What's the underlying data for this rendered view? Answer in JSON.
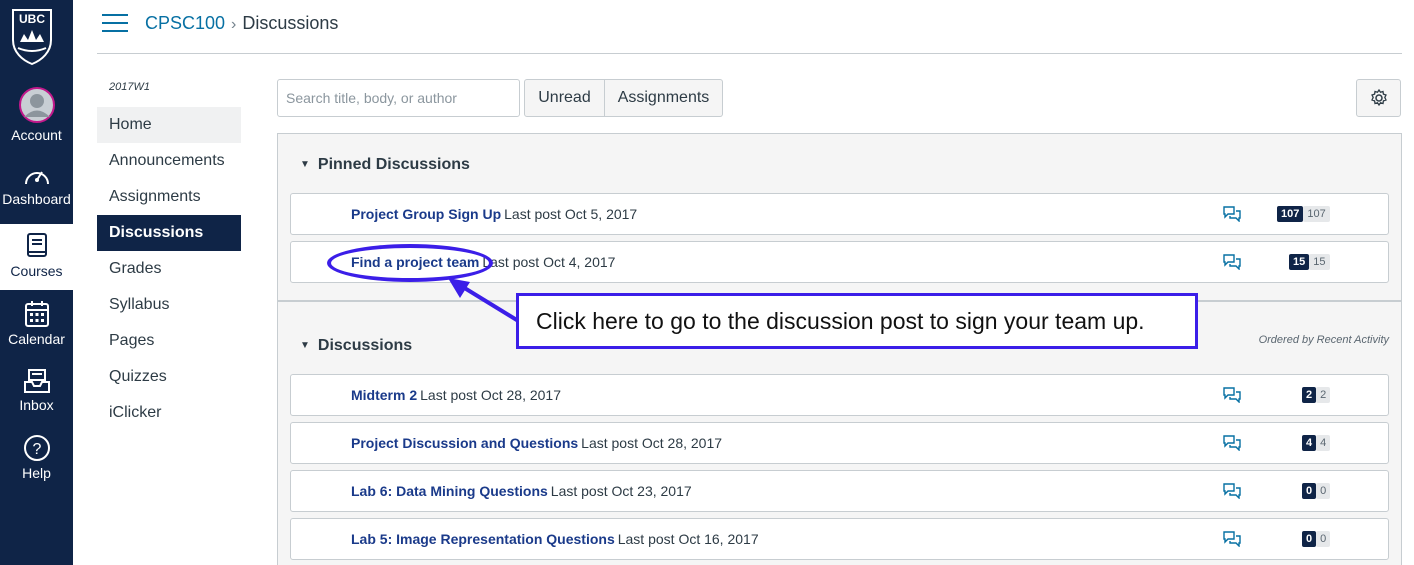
{
  "global_nav": {
    "logo_text": "UBC",
    "items": [
      {
        "label": "Account",
        "icon": "avatar-icon"
      },
      {
        "label": "Dashboard",
        "icon": "dashboard-icon"
      },
      {
        "label": "Courses",
        "icon": "book-icon"
      },
      {
        "label": "Calendar",
        "icon": "calendar-icon"
      },
      {
        "label": "Inbox",
        "icon": "inbox-icon"
      },
      {
        "label": "Help",
        "icon": "help-icon"
      }
    ]
  },
  "breadcrumb": {
    "course": "CPSC100",
    "separator": "›",
    "page": "Discussions"
  },
  "course_nav": {
    "term": "2017W1",
    "items": [
      "Home",
      "Announcements",
      "Assignments",
      "Discussions",
      "Grades",
      "Syllabus",
      "Pages",
      "Quizzes",
      "iClicker"
    ],
    "active": "Discussions"
  },
  "toolbar": {
    "search_placeholder": "Search title, body, or author",
    "unread_label": "Unread",
    "assignments_label": "Assignments",
    "settings_icon": "gear-icon"
  },
  "pinned": {
    "title": "Pinned Discussions",
    "rows": [
      {
        "title": "Project Group Sign Up",
        "meta": "Last post Oct 5, 2017",
        "unread": "107",
        "total": "107"
      },
      {
        "title": "Find a project team",
        "meta": "Last post Oct 4, 2017",
        "unread": "15",
        "total": "15"
      }
    ]
  },
  "discussions": {
    "title": "Discussions",
    "ordered_by": "Ordered by Recent Activity",
    "rows": [
      {
        "title": "Midterm 2",
        "meta": "Last post Oct 28, 2017",
        "unread": "2",
        "total": "2"
      },
      {
        "title": "Project Discussion and Questions",
        "meta": "Last post Oct 28, 2017",
        "unread": "4",
        "total": "4"
      },
      {
        "title": "Lab 6: Data Mining Questions",
        "meta": "Last post Oct 23, 2017",
        "unread": "0",
        "total": "0"
      },
      {
        "title": "Lab 5: Image Representation Questions",
        "meta": "Last post Oct 16, 2017",
        "unread": "0",
        "total": "0"
      }
    ]
  },
  "annotation": {
    "callout_text": "Click here to go to the discussion post to sign your team up.",
    "color": "#3b1ee8"
  }
}
